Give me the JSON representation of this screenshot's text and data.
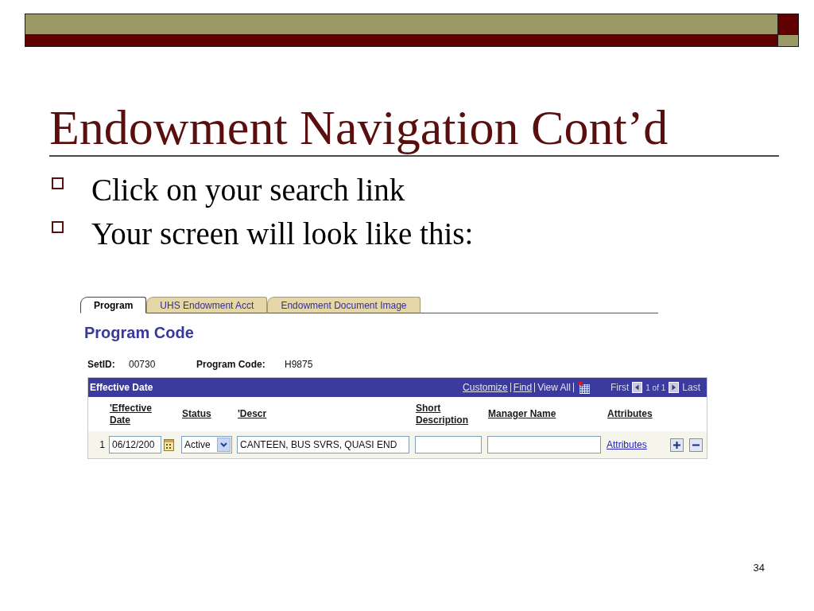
{
  "slide": {
    "title": "Endowment Navigation Cont’d",
    "bullets": [
      "Click on your search link",
      "Your screen will look like this:"
    ],
    "page_number": "34"
  },
  "screen": {
    "tabs": [
      {
        "label": "Program",
        "selected": true
      },
      {
        "label": "UHS Endowment Acct",
        "selected": false
      },
      {
        "label": "Endowment Document Image",
        "selected": false
      }
    ],
    "heading": "Program Code",
    "fields": [
      {
        "label": "SetID:",
        "value": "00730"
      },
      {
        "label": "Program Code:",
        "value": "H9875"
      }
    ],
    "grid": {
      "title": "Effective Date",
      "links": [
        {
          "label": "Customize",
          "disabled": false
        },
        {
          "label": "Find",
          "disabled": false
        },
        {
          "label": "View All",
          "disabled": true
        }
      ],
      "pager": {
        "first": "First",
        "range": "1 of 1",
        "last": "Last"
      },
      "columns": [
        "'Effective Date",
        "Status",
        "'Descr",
        "Short Description",
        "Manager Name",
        "Attributes"
      ],
      "rows": [
        {
          "number": "1",
          "cells": [
            {
              "kind": "date",
              "value": "06/12/200"
            },
            {
              "kind": "select",
              "value": "Active"
            },
            {
              "kind": "input",
              "value": "CANTEEN, BUS SVRS, QUASI END"
            },
            {
              "kind": "input"
            },
            {
              "kind": "input"
            },
            {
              "kind": "link",
              "value": "Attributes"
            }
          ]
        }
      ]
    }
  }
}
